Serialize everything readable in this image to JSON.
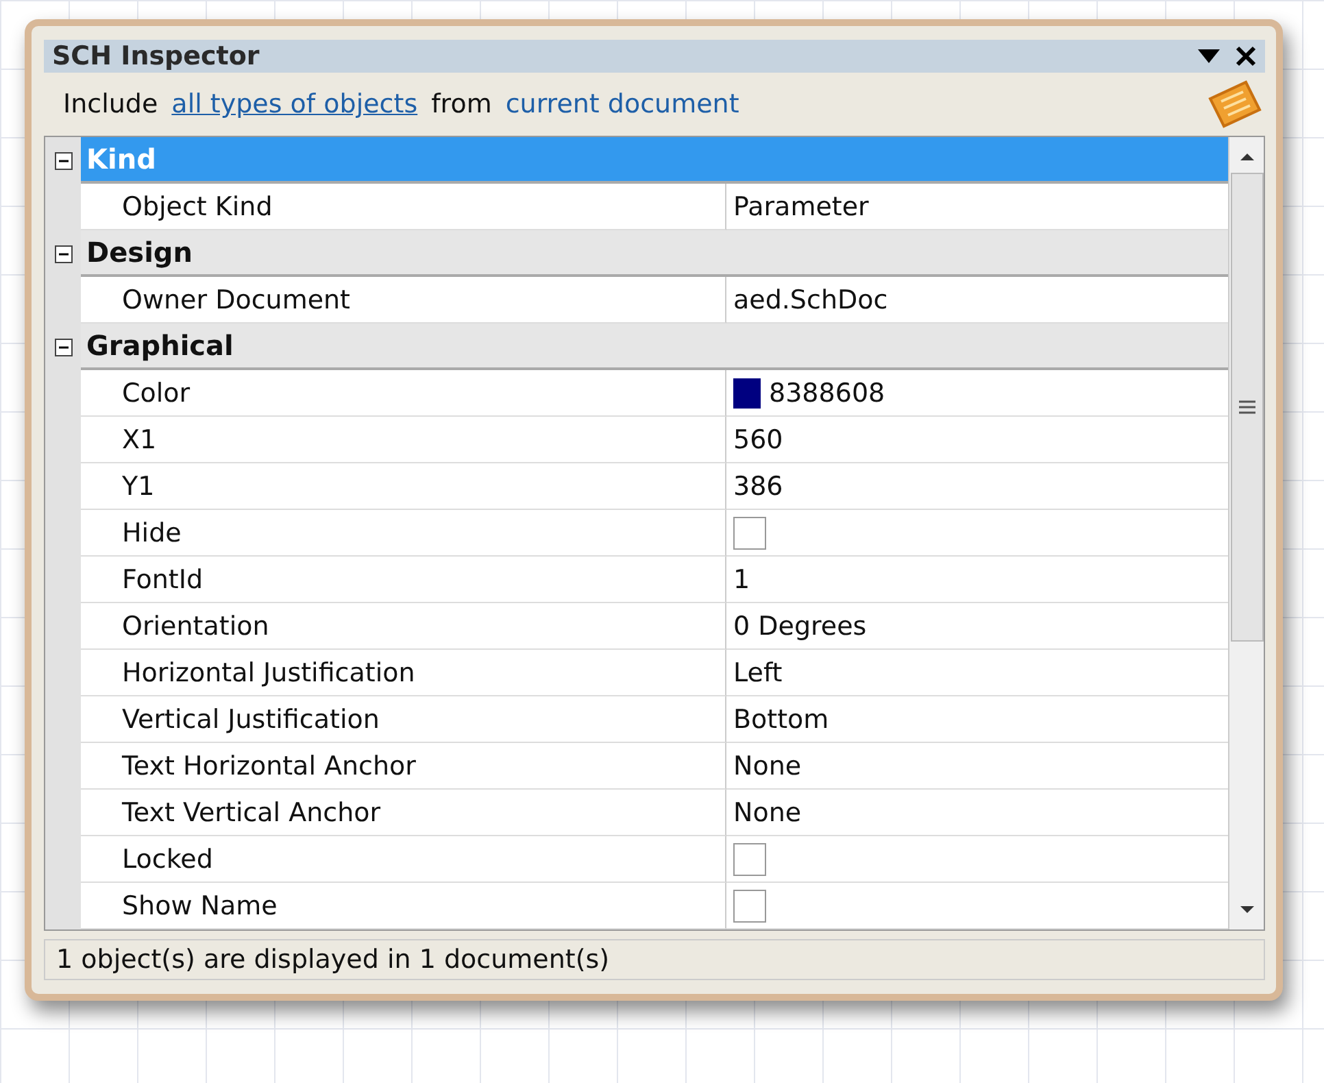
{
  "window": {
    "title": "SCH Inspector"
  },
  "filter": {
    "prefix": "Include",
    "objects_link": "all types of objects",
    "middle": "from",
    "scope_link": "current document"
  },
  "categories": [
    {
      "label": "Kind",
      "expanded": true,
      "selected": true,
      "properties": [
        {
          "kind": "text",
          "name": "Object Kind",
          "value": "Parameter"
        }
      ]
    },
    {
      "label": "Design",
      "expanded": true,
      "selected": false,
      "properties": [
        {
          "kind": "text",
          "name": "Owner Document",
          "value": "aed.SchDoc"
        }
      ]
    },
    {
      "label": "Graphical",
      "expanded": true,
      "selected": false,
      "properties": [
        {
          "kind": "color",
          "name": "Color",
          "value": "8388608",
          "color": "#000080"
        },
        {
          "kind": "text",
          "name": "X1",
          "value": "560"
        },
        {
          "kind": "text",
          "name": "Y1",
          "value": "386"
        },
        {
          "kind": "checkbox",
          "name": "Hide",
          "checked": false
        },
        {
          "kind": "text",
          "name": "FontId",
          "value": "1"
        },
        {
          "kind": "text",
          "name": "Orientation",
          "value": "0 Degrees"
        },
        {
          "kind": "text",
          "name": "Horizontal Justification",
          "value": "Left"
        },
        {
          "kind": "text",
          "name": "Vertical Justification",
          "value": "Bottom"
        },
        {
          "kind": "text",
          "name": "Text Horizontal Anchor",
          "value": "None"
        },
        {
          "kind": "text",
          "name": "Text Vertical Anchor",
          "value": "None"
        },
        {
          "kind": "checkbox",
          "name": "Locked",
          "checked": false
        },
        {
          "kind": "checkbox",
          "name": "Show Name",
          "checked": false
        }
      ]
    }
  ],
  "status_bar": "1 object(s) are displayed in 1 document(s)"
}
